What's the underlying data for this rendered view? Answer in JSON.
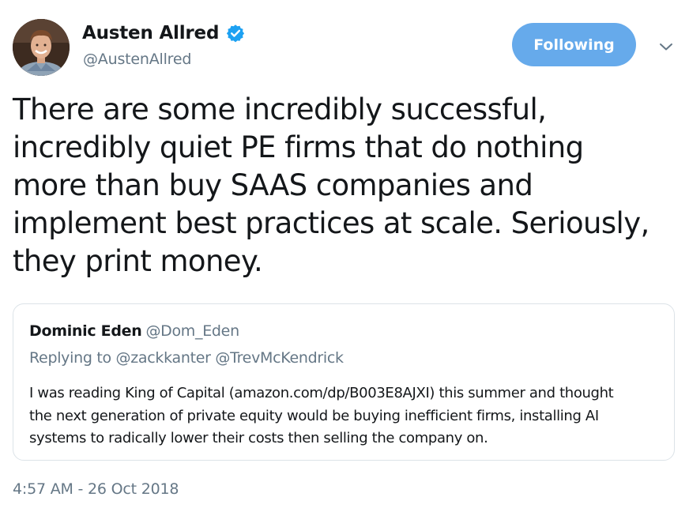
{
  "author": {
    "display_name": "Austen Allred",
    "username": "@AustenAllred",
    "verified": true,
    "avatar_icon": "profile-photo"
  },
  "actions": {
    "follow_label": "Following",
    "follow_color": "#66aaeb",
    "menu_icon": "chevron-down-icon"
  },
  "tweet": {
    "text": "There are some incredibly successful,\nincredibly quiet PE firms that do nothing\nmore than buy SAAS companies and\nimplement best practices at scale. Seriously,\nthey print money.",
    "timestamp": "4:57 AM - 26 Oct 2018"
  },
  "quoted_tweet": {
    "display_name": "Dominic Eden",
    "username": "@Dom_Eden",
    "replying_to": "Replying to @zackkanter @TrevMcKendrick",
    "text": "I was reading King of Capital (amazon.com/dp/B003E8AJXI) this summer and thought\nthe next generation of private equity would be buying inefficient firms, installing AI\nsystems to radically lower their costs then selling the company on."
  },
  "colors": {
    "text_primary": "#14171a",
    "text_secondary": "#657786",
    "verified_blue": "#1da1f2",
    "border": "#dce3e8"
  }
}
